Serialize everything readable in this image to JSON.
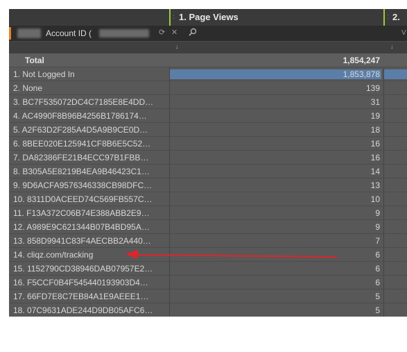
{
  "header": {
    "column1_title": "1. Page Views",
    "column2_title": "2.",
    "column_prefix": ":",
    "dimension_label": "Account ID (",
    "search_icon": "search-icon",
    "clear_icon": "close-icon",
    "refresh_icon": "refresh-icon",
    "truncated_header_text": "V",
    "sort_arrow": "↓"
  },
  "table": {
    "total": {
      "label": "Total",
      "value": "1,854,247"
    },
    "rows": [
      {
        "name": "1.  Not Logged In",
        "value": "1,853,878",
        "share": 0.9998
      },
      {
        "name": "2.  None",
        "value": "139"
      },
      {
        "name": "3.  BC7F535072DC4C7185E8E4DD…",
        "value": "31"
      },
      {
        "name": "4.  AC4990F8B96B4256B1786174…",
        "value": "19"
      },
      {
        "name": "5.  A2F63D2F285A4D5A9B9CE0D…",
        "value": "18"
      },
      {
        "name": "6.  8BEE020E125941CF8B6E5C52…",
        "value": "16"
      },
      {
        "name": "7.  DA82386FE21B4ECC97B1FBB…",
        "value": "16"
      },
      {
        "name": "8.  B305A5E8219B4EA9B46423C1…",
        "value": "14"
      },
      {
        "name": "9.  9D6ACFA9576346338CB98DFC…",
        "value": "13"
      },
      {
        "name": "10.  8311D0ACEED74C569FB557C…",
        "value": "10"
      },
      {
        "name": "11.  F13A372C06B74E388ABB2E9…",
        "value": "9"
      },
      {
        "name": "12.  A989E9C621344B07B4BD95A…",
        "value": "9"
      },
      {
        "name": "13.  858D9941C83F4AECBB2A440…",
        "value": "7"
      },
      {
        "name": "14.  cliqz.com/tracking",
        "value": "6"
      },
      {
        "name": "15.  1152790CD38946DAB07957E2…",
        "value": "6"
      },
      {
        "name": "16.  F5CCF0B4F545440193903D4…",
        "value": "6"
      },
      {
        "name": "17.  66FD7E8C7EB84A1E9AEEE1…",
        "value": "5"
      },
      {
        "name": "18.  07C9631ADE244D9DB05AFC6…",
        "value": "5"
      }
    ]
  },
  "annotation": {
    "arrow_color": "#e0242a",
    "points_to_row": 14
  },
  "colors": {
    "bar": "#5b7ea8",
    "accent_green": "#9acd32",
    "accent_orange": "#e8821e"
  }
}
